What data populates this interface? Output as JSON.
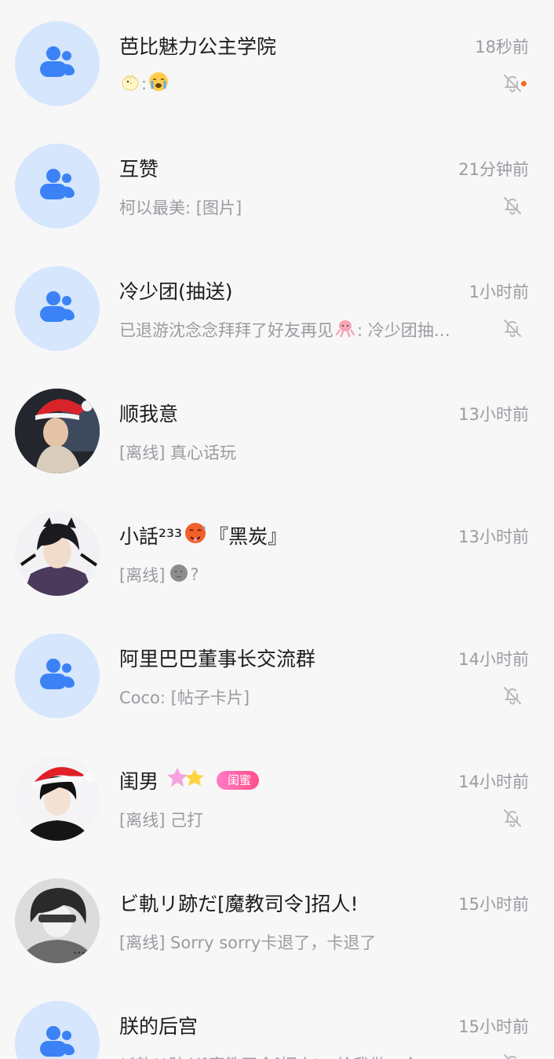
{
  "conversations": [
    {
      "title": "芭比魅力公主学院",
      "time": "18秒前",
      "preview_after": ":",
      "muted": true,
      "unread_dot": true
    },
    {
      "title": "互赞",
      "time": "21分钟前",
      "preview": "柯以最美: [图片]",
      "muted": true
    },
    {
      "title": "冷少团(抽送)",
      "time": "1小时前",
      "preview": "已退游沈念念拜拜了好友再见",
      "preview_after": ": 冷少团抽…",
      "muted": true
    },
    {
      "title": "顺我意",
      "time": "13小时前",
      "preview": "[离线] 真心话玩"
    },
    {
      "title": "小話²³³",
      "title_after": "『黑炭』",
      "time": "13小时前",
      "preview": "[离线]",
      "preview_after": "?"
    },
    {
      "title": "阿里巴巴董事长交流群",
      "time": "14小时前",
      "preview": "Coco: [帖子卡片]",
      "muted": true
    },
    {
      "title": "闺男",
      "badge": "闺蜜",
      "time": "14小时前",
      "preview": "[离线] 己打",
      "muted": true
    },
    {
      "title": "ビ軌リ跡だ[魔教司令]招人!",
      "time": "15小时前",
      "preview": "[离线] Sorry sorry卡退了，卡退了"
    },
    {
      "title": "朕的后宫",
      "time": "15小时前",
      "preview": "ビ軌リ跡だ[魔教司令]招人!：给我做一个",
      "muted": true
    }
  ],
  "colors": {
    "group_avatar_bg": "#d5e6fd",
    "group_icon": "#3b82f6",
    "unread_dot": "#f36f20"
  }
}
